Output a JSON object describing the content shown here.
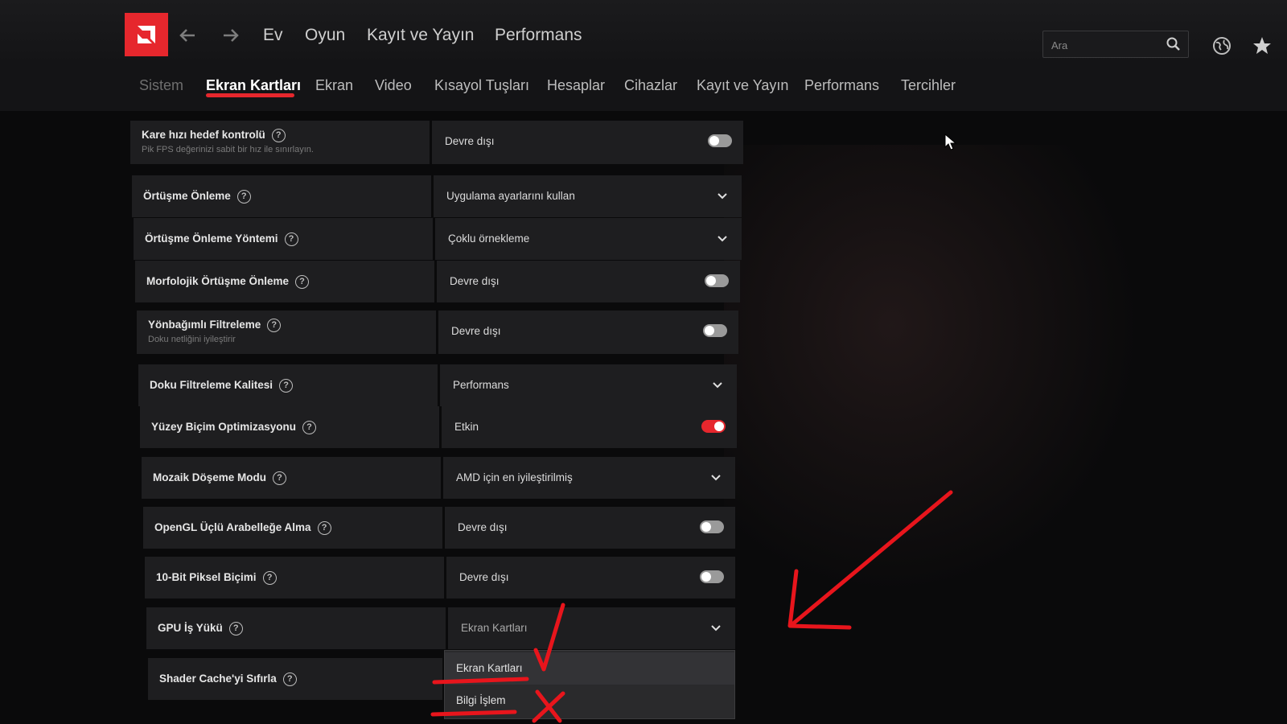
{
  "topnav": {
    "items": [
      "Ev",
      "Oyun",
      "Kayıt ve Yayın",
      "Performans"
    ]
  },
  "search": {
    "placeholder": "Ara"
  },
  "subtabs": [
    "Sistem",
    "Ekran Kartları",
    "Ekran",
    "Video",
    "Kısayol Tuşları",
    "Hesaplar",
    "Cihazlar",
    "Kayıt ve Yayın",
    "Performans",
    "Tercihler"
  ],
  "active_subtab": "Ekran Kartları",
  "settings": [
    {
      "label": "Kare hızı hedef kontrolü",
      "sub": "Pik FPS değerinizi sabit bir hız ile sınırlayın.",
      "value": "Devre dışı",
      "control": "toggle",
      "on": false
    },
    {
      "label": "Örtüşme Önleme",
      "value": "Uygulama ayarlarını kullan",
      "control": "dropdown"
    },
    {
      "label": "Örtüşme Önleme Yöntemi",
      "value": "Çoklu örnekleme",
      "control": "dropdown"
    },
    {
      "label": "Morfolojik Örtüşme Önleme",
      "value": "Devre dışı",
      "control": "toggle",
      "on": false
    },
    {
      "label": "Yönbağımlı Filtreleme",
      "sub": "Doku netliğini iyileştirir",
      "value": "Devre dışı",
      "control": "toggle",
      "on": false
    },
    {
      "label": "Doku Filtreleme Kalitesi",
      "value": "Performans",
      "control": "dropdown"
    },
    {
      "label": "Yüzey Biçim Optimizasyonu",
      "value": "Etkin",
      "control": "toggle",
      "on": true
    },
    {
      "label": "Mozaik Döşeme Modu",
      "value": "AMD için en iyileştirilmiş",
      "control": "dropdown"
    },
    {
      "label": "OpenGL Üçlü Arabelleğe Alma",
      "value": "Devre dışı",
      "control": "toggle",
      "on": false
    },
    {
      "label": "10-Bit Piksel Biçimi",
      "value": "Devre dışı",
      "control": "toggle",
      "on": false
    },
    {
      "label": "GPU İş Yükü",
      "value": "Ekran Kartları",
      "control": "dropdown"
    },
    {
      "label": "Shader Cache'yi Sıfırla",
      "value": "",
      "control": "none"
    }
  ],
  "dropdown_options": [
    "Ekran Kartları",
    "Bilgi İşlem"
  ],
  "colors": {
    "accent": "#e6272d",
    "annotation": "#e8151c"
  }
}
